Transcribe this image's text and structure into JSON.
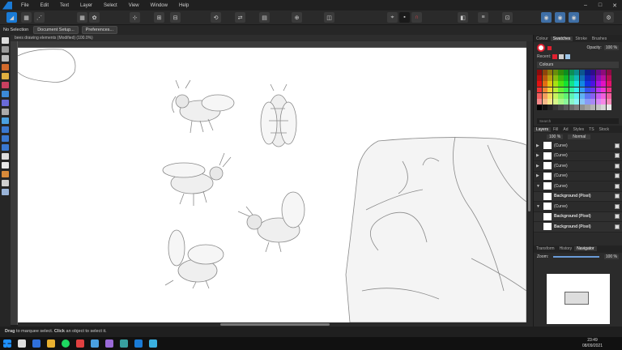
{
  "menubar": {
    "items": [
      "File",
      "Edit",
      "Text",
      "Layer",
      "Select",
      "View",
      "Window",
      "Help"
    ],
    "window_controls": [
      "–",
      "□",
      "✕"
    ]
  },
  "context_toolbar": {
    "status": "No Selection",
    "document_setup": "Document Setup...",
    "preferences": "Preferences..."
  },
  "document": {
    "tab_title": "bees drawing elements (Modified) (100.0%)"
  },
  "panel": {
    "top_tabs": [
      "Colour",
      "Swatches",
      "Stroke",
      "Brushes"
    ],
    "active_top_tab": "Swatches",
    "opacity_label": "Opacity:",
    "opacity_value": "100 %",
    "recent_label": "Recent:",
    "palette_name": "Colours",
    "search_placeholder": "Search",
    "layer_tabs": [
      "Layers",
      "Fill",
      "Ad",
      "Styles",
      "TS",
      "Stock"
    ],
    "active_layer_tab": "Layers",
    "blend_opacity": "100 %",
    "blend_mode": "Normal",
    "layers": [
      {
        "name": "(Curve)",
        "expander": "▶",
        "bold": false
      },
      {
        "name": "(Curve)",
        "expander": "▶",
        "bold": false
      },
      {
        "name": "(Curve)",
        "expander": "▶",
        "bold": false
      },
      {
        "name": "(Curve)",
        "expander": "▶",
        "bold": false
      },
      {
        "name": "(Curve)",
        "expander": "▼",
        "bold": false
      },
      {
        "name": "Background (Pixel)",
        "expander": "",
        "bold": true
      },
      {
        "name": "(Curve)",
        "expander": "▼",
        "bold": false
      },
      {
        "name": "Background (Pixel)",
        "expander": "",
        "bold": true
      },
      {
        "name": "Background (Pixel)",
        "expander": "",
        "bold": true
      }
    ],
    "bottom_tabs": [
      "Transform",
      "History",
      "Navigator"
    ],
    "active_bottom_tab": "Navigator",
    "zoom_label": "Zoom:",
    "zoom_value": "100 %"
  },
  "statusbar": {
    "bold1": "Drag",
    "text1": " to marquee select. ",
    "bold2": "Click",
    "text2": " an object to select it."
  },
  "taskbar": {
    "time": "23:49",
    "date": "08/09/2021"
  },
  "colors": {
    "accent": "#1a7bd6",
    "bg": "#2b2b2b"
  }
}
